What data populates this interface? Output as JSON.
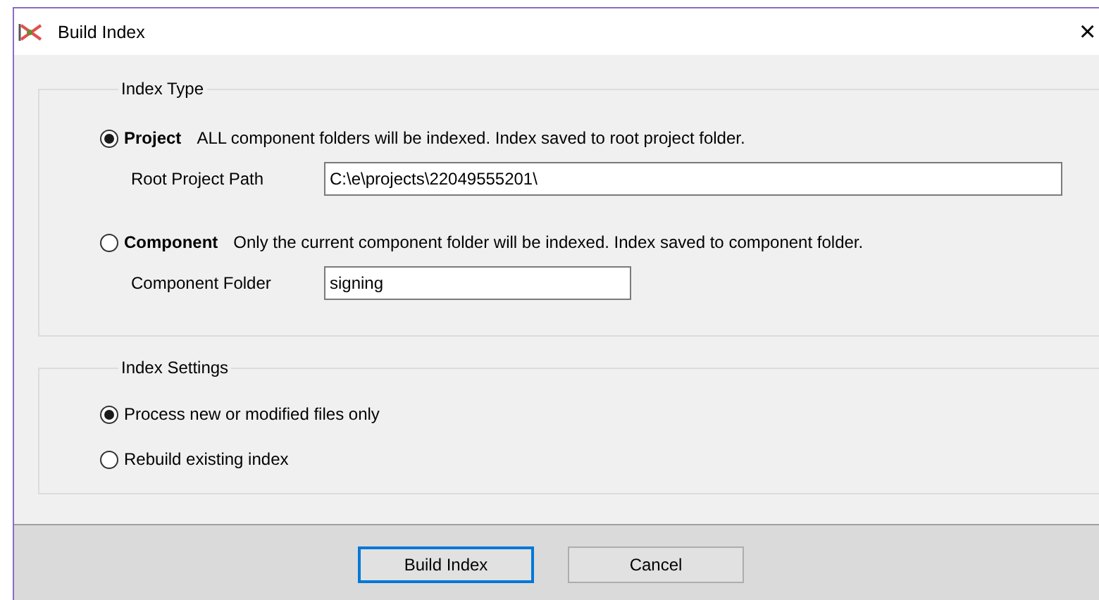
{
  "window": {
    "title": "Build Index",
    "close": "×"
  },
  "index_type": {
    "legend": "Index Type",
    "options": [
      {
        "label": "Project",
        "description": "ALL component folders will be indexed.  Index saved to root project folder.",
        "selected": true,
        "field": {
          "label": "Root Project Path",
          "value": "C:\\e\\projects\\22049555201\\"
        }
      },
      {
        "label": "Component",
        "description": "Only the current component folder will be indexed.  Index saved to component folder.",
        "selected": false,
        "field": {
          "label": "Component Folder",
          "value": "signing"
        }
      }
    ]
  },
  "index_settings": {
    "legend": "Index Settings",
    "options": [
      {
        "label": "Process new or modified files only",
        "selected": true
      },
      {
        "label": "Rebuild existing index",
        "selected": false
      }
    ]
  },
  "buttons": [
    {
      "label": "Build Index",
      "default": true
    },
    {
      "label": "Cancel",
      "default": false
    }
  ]
}
